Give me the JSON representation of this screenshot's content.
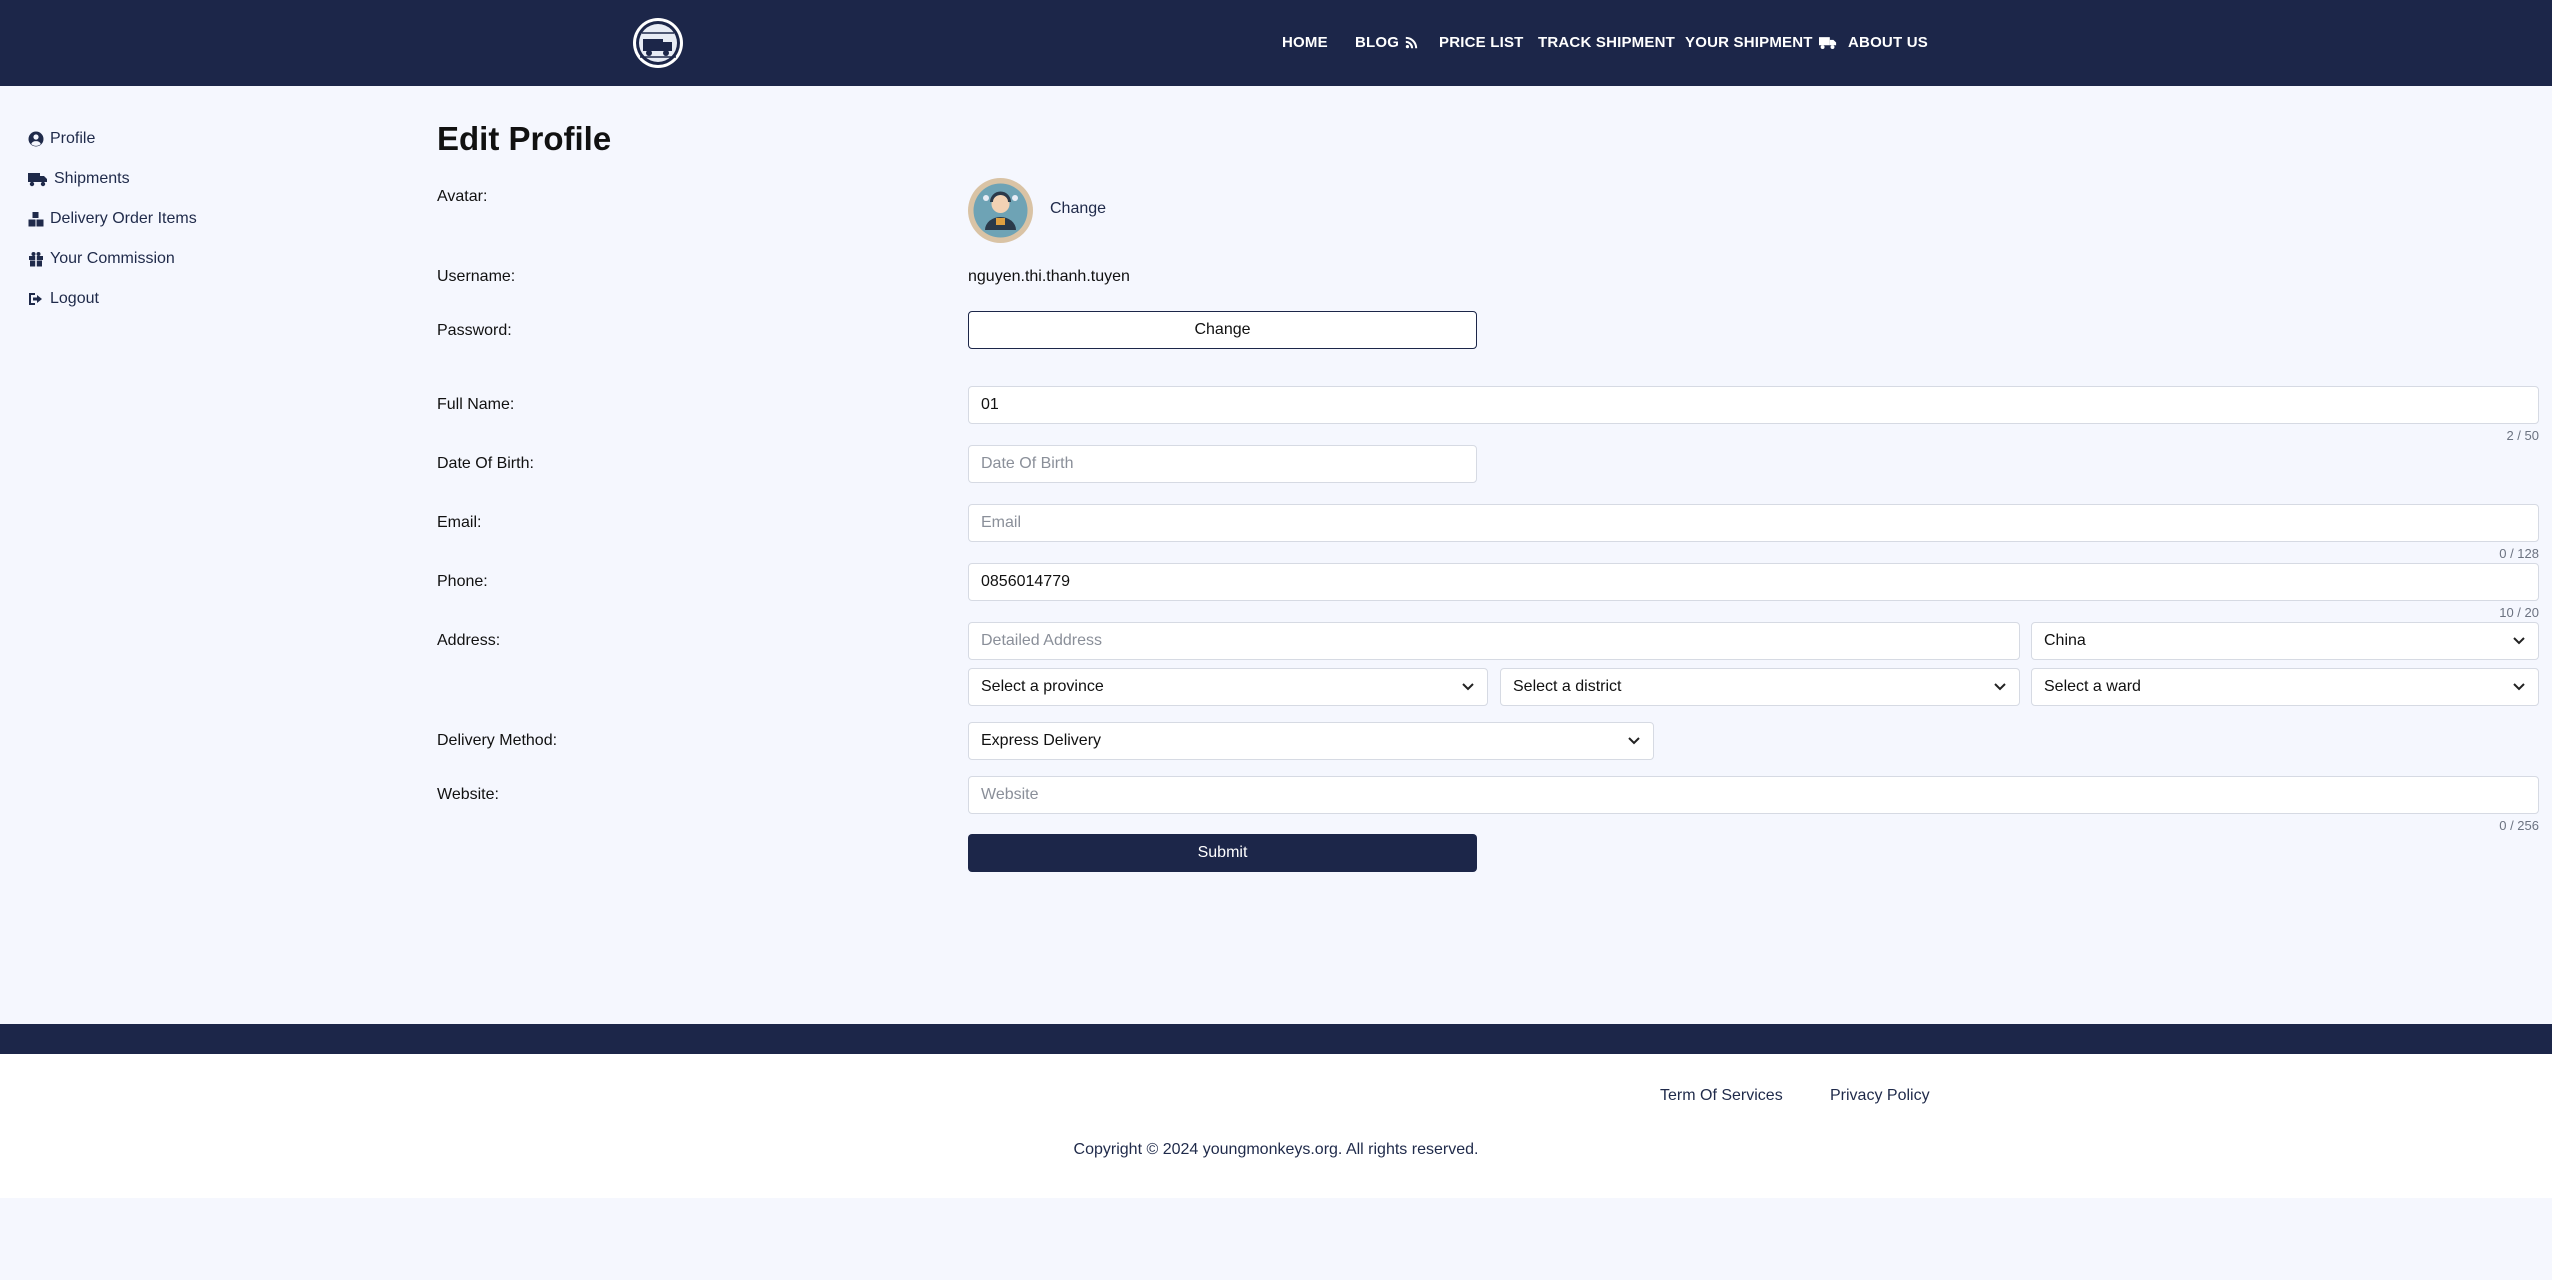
{
  "header": {
    "nav": [
      {
        "label": "HOME",
        "icon": ""
      },
      {
        "label": "BLOG",
        "icon": "rss-icon"
      },
      {
        "label": "PRICE LIST",
        "icon": ""
      },
      {
        "label": "TRACK SHIPMENT",
        "icon": ""
      },
      {
        "label": "YOUR SHIPMENT",
        "icon": "truck-icon"
      },
      {
        "label": "ABOUT US",
        "icon": ""
      }
    ]
  },
  "sidebar": {
    "items": [
      {
        "label": "Profile",
        "icon": "user-circle-icon"
      },
      {
        "label": "Shipments",
        "icon": "truck-icon"
      },
      {
        "label": "Delivery Order Items",
        "icon": "boxes-icon"
      },
      {
        "label": "Your Commission",
        "icon": "gift-icon"
      },
      {
        "label": "Logout",
        "icon": "logout-icon"
      }
    ]
  },
  "form": {
    "title": "Edit Profile",
    "avatar": {
      "label": "Avatar:",
      "change": "Change"
    },
    "username": {
      "label": "Username:",
      "value": "nguyen.thi.thanh.tuyen"
    },
    "password": {
      "label": "Password:",
      "button": "Change"
    },
    "full_name": {
      "label": "Full Name:",
      "value": "01",
      "counter": "2 / 50"
    },
    "dob": {
      "label": "Date Of Birth:",
      "placeholder": "Date Of Birth"
    },
    "email": {
      "label": "Email:",
      "placeholder": "Email",
      "counter": "0 / 128"
    },
    "phone": {
      "label": "Phone:",
      "value": "0856014779",
      "counter": "10 / 20"
    },
    "address": {
      "label": "Address:",
      "detail_placeholder": "Detailed Address",
      "country": "China",
      "province": "Select a province",
      "district": "Select a district",
      "ward": "Select a ward"
    },
    "delivery": {
      "label": "Delivery Method:",
      "value": "Express Delivery"
    },
    "website": {
      "label": "Website:",
      "placeholder": "Website",
      "counter": "0 / 256"
    },
    "submit": "Submit"
  },
  "footer": {
    "terms": "Term Of Services",
    "privacy": "Privacy Policy",
    "copyright": "Copyright © 2024 youngmonkeys.org. All rights reserved."
  },
  "colors": {
    "primary": "#1c2649",
    "background": "#f5f7fe",
    "link": "#1f2a4a"
  }
}
